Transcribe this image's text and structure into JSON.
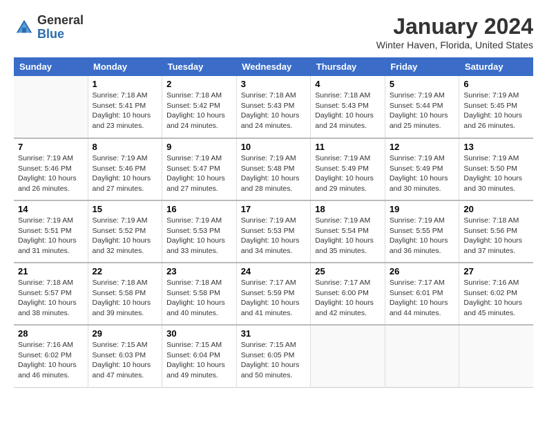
{
  "logo": {
    "general": "General",
    "blue": "Blue"
  },
  "title": "January 2024",
  "location": "Winter Haven, Florida, United States",
  "days_of_week": [
    "Sunday",
    "Monday",
    "Tuesday",
    "Wednesday",
    "Thursday",
    "Friday",
    "Saturday"
  ],
  "weeks": [
    [
      {
        "num": "",
        "sunrise": "",
        "sunset": "",
        "daylight": "",
        "empty": true
      },
      {
        "num": "1",
        "sunrise": "Sunrise: 7:18 AM",
        "sunset": "Sunset: 5:41 PM",
        "daylight": "Daylight: 10 hours and 23 minutes."
      },
      {
        "num": "2",
        "sunrise": "Sunrise: 7:18 AM",
        "sunset": "Sunset: 5:42 PM",
        "daylight": "Daylight: 10 hours and 24 minutes."
      },
      {
        "num": "3",
        "sunrise": "Sunrise: 7:18 AM",
        "sunset": "Sunset: 5:43 PM",
        "daylight": "Daylight: 10 hours and 24 minutes."
      },
      {
        "num": "4",
        "sunrise": "Sunrise: 7:18 AM",
        "sunset": "Sunset: 5:43 PM",
        "daylight": "Daylight: 10 hours and 24 minutes."
      },
      {
        "num": "5",
        "sunrise": "Sunrise: 7:19 AM",
        "sunset": "Sunset: 5:44 PM",
        "daylight": "Daylight: 10 hours and 25 minutes."
      },
      {
        "num": "6",
        "sunrise": "Sunrise: 7:19 AM",
        "sunset": "Sunset: 5:45 PM",
        "daylight": "Daylight: 10 hours and 26 minutes."
      }
    ],
    [
      {
        "num": "7",
        "sunrise": "Sunrise: 7:19 AM",
        "sunset": "Sunset: 5:46 PM",
        "daylight": "Daylight: 10 hours and 26 minutes."
      },
      {
        "num": "8",
        "sunrise": "Sunrise: 7:19 AM",
        "sunset": "Sunset: 5:46 PM",
        "daylight": "Daylight: 10 hours and 27 minutes."
      },
      {
        "num": "9",
        "sunrise": "Sunrise: 7:19 AM",
        "sunset": "Sunset: 5:47 PM",
        "daylight": "Daylight: 10 hours and 27 minutes."
      },
      {
        "num": "10",
        "sunrise": "Sunrise: 7:19 AM",
        "sunset": "Sunset: 5:48 PM",
        "daylight": "Daylight: 10 hours and 28 minutes."
      },
      {
        "num": "11",
        "sunrise": "Sunrise: 7:19 AM",
        "sunset": "Sunset: 5:49 PM",
        "daylight": "Daylight: 10 hours and 29 minutes."
      },
      {
        "num": "12",
        "sunrise": "Sunrise: 7:19 AM",
        "sunset": "Sunset: 5:49 PM",
        "daylight": "Daylight: 10 hours and 30 minutes."
      },
      {
        "num": "13",
        "sunrise": "Sunrise: 7:19 AM",
        "sunset": "Sunset: 5:50 PM",
        "daylight": "Daylight: 10 hours and 30 minutes."
      }
    ],
    [
      {
        "num": "14",
        "sunrise": "Sunrise: 7:19 AM",
        "sunset": "Sunset: 5:51 PM",
        "daylight": "Daylight: 10 hours and 31 minutes."
      },
      {
        "num": "15",
        "sunrise": "Sunrise: 7:19 AM",
        "sunset": "Sunset: 5:52 PM",
        "daylight": "Daylight: 10 hours and 32 minutes."
      },
      {
        "num": "16",
        "sunrise": "Sunrise: 7:19 AM",
        "sunset": "Sunset: 5:53 PM",
        "daylight": "Daylight: 10 hours and 33 minutes."
      },
      {
        "num": "17",
        "sunrise": "Sunrise: 7:19 AM",
        "sunset": "Sunset: 5:53 PM",
        "daylight": "Daylight: 10 hours and 34 minutes."
      },
      {
        "num": "18",
        "sunrise": "Sunrise: 7:19 AM",
        "sunset": "Sunset: 5:54 PM",
        "daylight": "Daylight: 10 hours and 35 minutes."
      },
      {
        "num": "19",
        "sunrise": "Sunrise: 7:19 AM",
        "sunset": "Sunset: 5:55 PM",
        "daylight": "Daylight: 10 hours and 36 minutes."
      },
      {
        "num": "20",
        "sunrise": "Sunrise: 7:18 AM",
        "sunset": "Sunset: 5:56 PM",
        "daylight": "Daylight: 10 hours and 37 minutes."
      }
    ],
    [
      {
        "num": "21",
        "sunrise": "Sunrise: 7:18 AM",
        "sunset": "Sunset: 5:57 PM",
        "daylight": "Daylight: 10 hours and 38 minutes."
      },
      {
        "num": "22",
        "sunrise": "Sunrise: 7:18 AM",
        "sunset": "Sunset: 5:58 PM",
        "daylight": "Daylight: 10 hours and 39 minutes."
      },
      {
        "num": "23",
        "sunrise": "Sunrise: 7:18 AM",
        "sunset": "Sunset: 5:58 PM",
        "daylight": "Daylight: 10 hours and 40 minutes."
      },
      {
        "num": "24",
        "sunrise": "Sunrise: 7:17 AM",
        "sunset": "Sunset: 5:59 PM",
        "daylight": "Daylight: 10 hours and 41 minutes."
      },
      {
        "num": "25",
        "sunrise": "Sunrise: 7:17 AM",
        "sunset": "Sunset: 6:00 PM",
        "daylight": "Daylight: 10 hours and 42 minutes."
      },
      {
        "num": "26",
        "sunrise": "Sunrise: 7:17 AM",
        "sunset": "Sunset: 6:01 PM",
        "daylight": "Daylight: 10 hours and 44 minutes."
      },
      {
        "num": "27",
        "sunrise": "Sunrise: 7:16 AM",
        "sunset": "Sunset: 6:02 PM",
        "daylight": "Daylight: 10 hours and 45 minutes."
      }
    ],
    [
      {
        "num": "28",
        "sunrise": "Sunrise: 7:16 AM",
        "sunset": "Sunset: 6:02 PM",
        "daylight": "Daylight: 10 hours and 46 minutes."
      },
      {
        "num": "29",
        "sunrise": "Sunrise: 7:15 AM",
        "sunset": "Sunset: 6:03 PM",
        "daylight": "Daylight: 10 hours and 47 minutes."
      },
      {
        "num": "30",
        "sunrise": "Sunrise: 7:15 AM",
        "sunset": "Sunset: 6:04 PM",
        "daylight": "Daylight: 10 hours and 49 minutes."
      },
      {
        "num": "31",
        "sunrise": "Sunrise: 7:15 AM",
        "sunset": "Sunset: 6:05 PM",
        "daylight": "Daylight: 10 hours and 50 minutes."
      },
      {
        "num": "",
        "sunrise": "",
        "sunset": "",
        "daylight": "",
        "empty": true
      },
      {
        "num": "",
        "sunrise": "",
        "sunset": "",
        "daylight": "",
        "empty": true
      },
      {
        "num": "",
        "sunrise": "",
        "sunset": "",
        "daylight": "",
        "empty": true
      }
    ]
  ]
}
